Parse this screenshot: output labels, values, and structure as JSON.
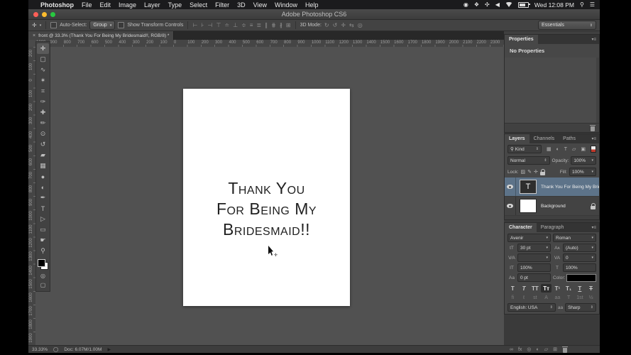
{
  "menubar": {
    "apple": "",
    "items": [
      "Photoshop",
      "File",
      "Edit",
      "Image",
      "Layer",
      "Type",
      "Select",
      "Filter",
      "3D",
      "View",
      "Window",
      "Help"
    ],
    "tray": {
      "record": "◉",
      "dropbox": "❖",
      "extra": "✣",
      "volume": "◀",
      "clock": "Wed 12:08 PM",
      "spotlight": "⚲",
      "list": "☰"
    }
  },
  "window": {
    "title": "Adobe Photoshop CS6"
  },
  "options_bar": {
    "tool_icon": "✛",
    "auto_select_label": "Auto-Select:",
    "auto_select_value": "Group",
    "show_transform_label": "Show Transform Controls",
    "align_icons": [
      {
        "name": "align-left-edges-icon",
        "glyph": "⊢"
      },
      {
        "name": "align-horizontal-centers-icon",
        "glyph": "⊦"
      },
      {
        "name": "align-right-edges-icon",
        "glyph": "⊣"
      },
      {
        "name": "align-top-edges-icon",
        "glyph": "⊤"
      },
      {
        "name": "align-vertical-centers-icon",
        "glyph": "≐"
      },
      {
        "name": "align-bottom-edges-icon",
        "glyph": "⊥"
      },
      {
        "name": "distribute-top-edges-icon",
        "glyph": "≑"
      },
      {
        "name": "distribute-vertical-centers-icon",
        "glyph": "≡"
      },
      {
        "name": "distribute-bottom-edges-icon",
        "glyph": "≣"
      },
      {
        "name": "distribute-left-edges-icon",
        "glyph": "∥"
      },
      {
        "name": "distribute-horizontal-centers-icon",
        "glyph": "⋕"
      },
      {
        "name": "distribute-right-edges-icon",
        "glyph": "∦"
      },
      {
        "name": "auto-align-layers-icon",
        "glyph": "⊞"
      }
    ],
    "mode_label": "3D Mode:",
    "mode_icons": [
      {
        "name": "3d-rotate-icon",
        "glyph": "↻"
      },
      {
        "name": "3d-roll-icon",
        "glyph": "↺"
      },
      {
        "name": "3d-drag-icon",
        "glyph": "✛"
      },
      {
        "name": "3d-slide-icon",
        "glyph": "⇆"
      },
      {
        "name": "3d-scale-icon",
        "glyph": "◎"
      }
    ],
    "workspace": "Essentials"
  },
  "document_tab": {
    "close": "×",
    "title": "front @ 33.3% (Thank You For Being My Bridesmaid!!, RGB/8) *"
  },
  "rulers": {
    "horizontal": [
      "1000",
      "900",
      "800",
      "700",
      "600",
      "500",
      "400",
      "300",
      "200",
      "100",
      "0",
      "100",
      "200",
      "300",
      "400",
      "500",
      "600",
      "700",
      "800",
      "900",
      "1000",
      "1100",
      "1200",
      "1300",
      "1400",
      "1500",
      "1600",
      "1700",
      "1800",
      "1900",
      "2000",
      "2100",
      "2200",
      "2300"
    ],
    "vertical": [
      "200",
      "100",
      "0",
      "100",
      "200",
      "300",
      "400",
      "500",
      "600",
      "700",
      "800",
      "900",
      "1000",
      "1100",
      "1200",
      "1300",
      "1400",
      "1500",
      "1600",
      "1700",
      "1800",
      "1900"
    ]
  },
  "toolbar": {
    "tools": [
      {
        "name": "move-tool",
        "glyph": "✛"
      },
      {
        "name": "marquee-tool",
        "glyph": "▢"
      },
      {
        "name": "lasso-tool",
        "glyph": "∿"
      },
      {
        "name": "quick-selection-tool",
        "glyph": "✶"
      },
      {
        "name": "crop-tool",
        "glyph": "⌗"
      },
      {
        "name": "eyedropper-tool",
        "glyph": "✑"
      },
      {
        "name": "healing-brush-tool",
        "glyph": "✚"
      },
      {
        "name": "brush-tool",
        "glyph": "✏"
      },
      {
        "name": "clone-stamp-tool",
        "glyph": "⊙"
      },
      {
        "name": "history-brush-tool",
        "glyph": "↺"
      },
      {
        "name": "eraser-tool",
        "glyph": "▰"
      },
      {
        "name": "gradient-tool",
        "glyph": "▦"
      },
      {
        "name": "blur-tool",
        "glyph": "●"
      },
      {
        "name": "dodge-tool",
        "glyph": "◐"
      },
      {
        "name": "pen-tool",
        "glyph": "✒"
      },
      {
        "name": "type-tool",
        "glyph": "T"
      },
      {
        "name": "path-selection-tool",
        "glyph": "▷"
      },
      {
        "name": "shape-tool",
        "glyph": "▭"
      },
      {
        "name": "hand-tool",
        "glyph": "☛"
      },
      {
        "name": "zoom-tool",
        "glyph": "⚲"
      }
    ]
  },
  "canvas": {
    "lines": [
      "Thank You",
      "For Being My",
      "Bridesmaid!!"
    ]
  },
  "panels": {
    "properties": {
      "tab": "Properties",
      "empty_label": "No Properties"
    },
    "layers": {
      "tabs": [
        "Layers",
        "Channels",
        "Paths"
      ],
      "filter_label": "Kind",
      "filter_icons": [
        {
          "name": "filter-pixel-layers-icon",
          "glyph": "▦"
        },
        {
          "name": "filter-adjustment-layers-icon",
          "glyph": "◐"
        },
        {
          "name": "filter-type-layers-icon",
          "glyph": "T"
        },
        {
          "name": "filter-shape-layers-icon",
          "glyph": "▱"
        },
        {
          "name": "filter-smart-objects-icon",
          "glyph": "▣"
        }
      ],
      "blend_mode": "Normal",
      "opacity_label": "Opacity:",
      "opacity_value": "100%",
      "lock_label": "Lock:",
      "lock_icons": [
        {
          "name": "lock-transparency-icon",
          "glyph": "▨"
        },
        {
          "name": "lock-pixels-icon",
          "glyph": "✎"
        },
        {
          "name": "lock-position-icon",
          "glyph": "✛"
        }
      ],
      "fill_label": "Fill:",
      "fill_value": "100%",
      "rows": [
        {
          "name": "Thank You For Being My Bride...",
          "thumb": "T"
        },
        {
          "name": "Background"
        }
      ]
    },
    "character": {
      "tabs": [
        "Character",
        "Paragraph"
      ],
      "font_family": "Avenir",
      "font_style": "Roman",
      "size_icon": "tT",
      "size_value": "30 pt",
      "leading_icon": "Aᴀ",
      "leading_value": "(Auto)",
      "kerning_icon": "V⁄A",
      "kerning_value": "",
      "tracking_icon": "VA",
      "tracking_value": "0",
      "vscale_icon": "IT",
      "vscale_value": "100%",
      "hscale_icon": "T",
      "hscale_value": "100%",
      "baseline_icon": "Aa",
      "baseline_value": "0 pt",
      "color_label": "Color:",
      "style_buttons": [
        "T",
        "T",
        "TT",
        "Tᴛ",
        "T¹",
        "T₁",
        "T",
        "T"
      ],
      "opentype_buttons": [
        "fi",
        "ℓ",
        "st",
        "A",
        "aa",
        "T",
        "1st",
        "½"
      ],
      "language_value": "English: USA",
      "aa_label": "aa",
      "aa_value": "Sharp"
    }
  },
  "status_bar": {
    "zoom": "33.33%",
    "badge": "◯",
    "doc": "Doc: 6.07M/1.00M",
    "arrow": "▶",
    "icons": [
      {
        "name": "link-layers-icon",
        "glyph": "∞"
      },
      {
        "name": "layer-effects-icon",
        "glyph": "fx"
      },
      {
        "name": "layer-mask-icon",
        "glyph": "◎"
      },
      {
        "name": "adjustment-layer-icon",
        "glyph": "◐"
      },
      {
        "name": "layer-group-icon",
        "glyph": "▱"
      },
      {
        "name": "new-layer-icon",
        "glyph": "⊞"
      }
    ]
  }
}
